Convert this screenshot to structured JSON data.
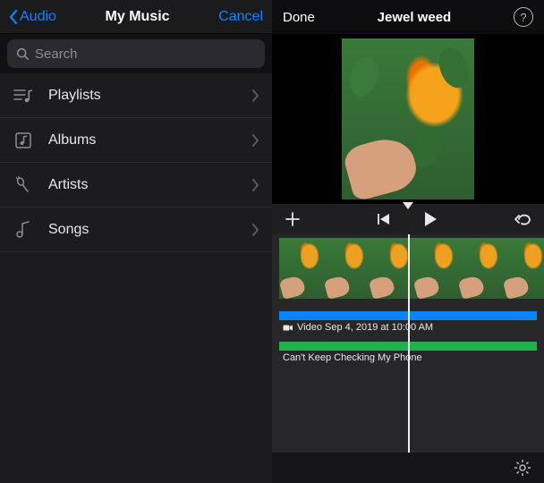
{
  "left": {
    "back_label": "Audio",
    "title": "My Music",
    "cancel_label": "Cancel",
    "search": {
      "placeholder": "Search",
      "value": ""
    },
    "rows": [
      {
        "icon": "playlists",
        "label": "Playlists"
      },
      {
        "icon": "albums",
        "label": "Albums"
      },
      {
        "icon": "artists",
        "label": "Artists"
      },
      {
        "icon": "songs",
        "label": "Songs"
      }
    ]
  },
  "right": {
    "done_label": "Done",
    "title": "Jewel weed",
    "help_label": "?",
    "tracks": {
      "video_label": "Video Sep 4, 2019 at 10:00 AM",
      "audio_label": "Can't Keep Checking My Phone"
    },
    "colors": {
      "video_track": "#0a84ff",
      "audio_track": "#20b24a"
    }
  }
}
